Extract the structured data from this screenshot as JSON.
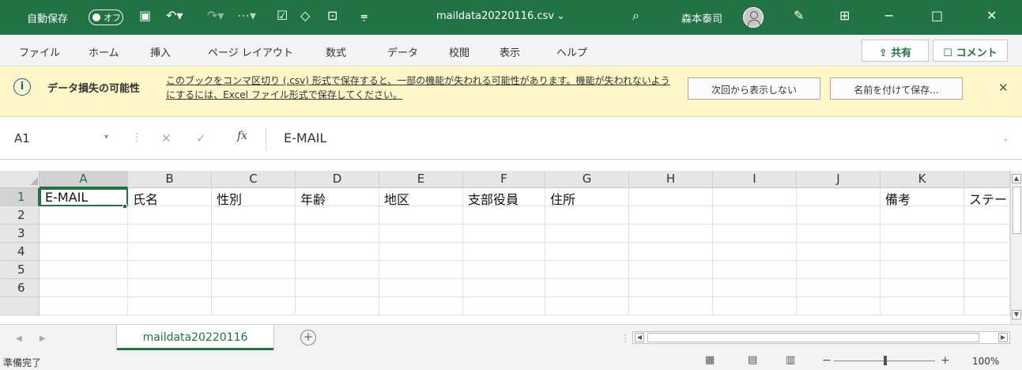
{
  "titlebar": {
    "autosave_label": "自動保存",
    "autosave_state": "オフ",
    "filename": "maildata20220116.csv",
    "user_name": "森本泰司"
  },
  "ribbon": {
    "tabs": [
      "ファイル",
      "ホーム",
      "挿入",
      "ページ レイアウト",
      "数式",
      "データ",
      "校閲",
      "表示",
      "ヘルプ"
    ],
    "share_label": "共有",
    "comment_label": "コメント"
  },
  "message_bar": {
    "title": "データ損失の可能性",
    "text": "このブックをコンマ区切り (.csv) 形式で保存すると、一部の機能が失われる可能性があります。機能が失われないようにするには、Excel ファイル形式で保存してください。",
    "dont_show_button": "次回から表示しない",
    "save_as_button": "名前を付けて保存..."
  },
  "formula_bar": {
    "name_box": "A1",
    "fx_label": "fx",
    "content": "E-MAIL"
  },
  "grid": {
    "columns": [
      "A",
      "B",
      "C",
      "D",
      "E",
      "F",
      "G",
      "H",
      "I",
      "J",
      "K",
      ""
    ],
    "rows": [
      "1",
      "2",
      "3",
      "4",
      "5",
      "6"
    ],
    "row1": [
      "E-MAIL",
      "氏名",
      "性別",
      "年齢",
      "地区",
      "支部役員",
      "住所",
      "",
      "",
      "",
      "備考",
      "ステー"
    ],
    "active_cell": "A1"
  },
  "sheets": {
    "tabs": [
      "maildata20220116"
    ],
    "add_sheet": "+"
  },
  "status": {
    "ready": "準備完了",
    "zoom": "100%"
  },
  "colors": {
    "accent": "#217346",
    "message_bg": "#fff6c8"
  }
}
